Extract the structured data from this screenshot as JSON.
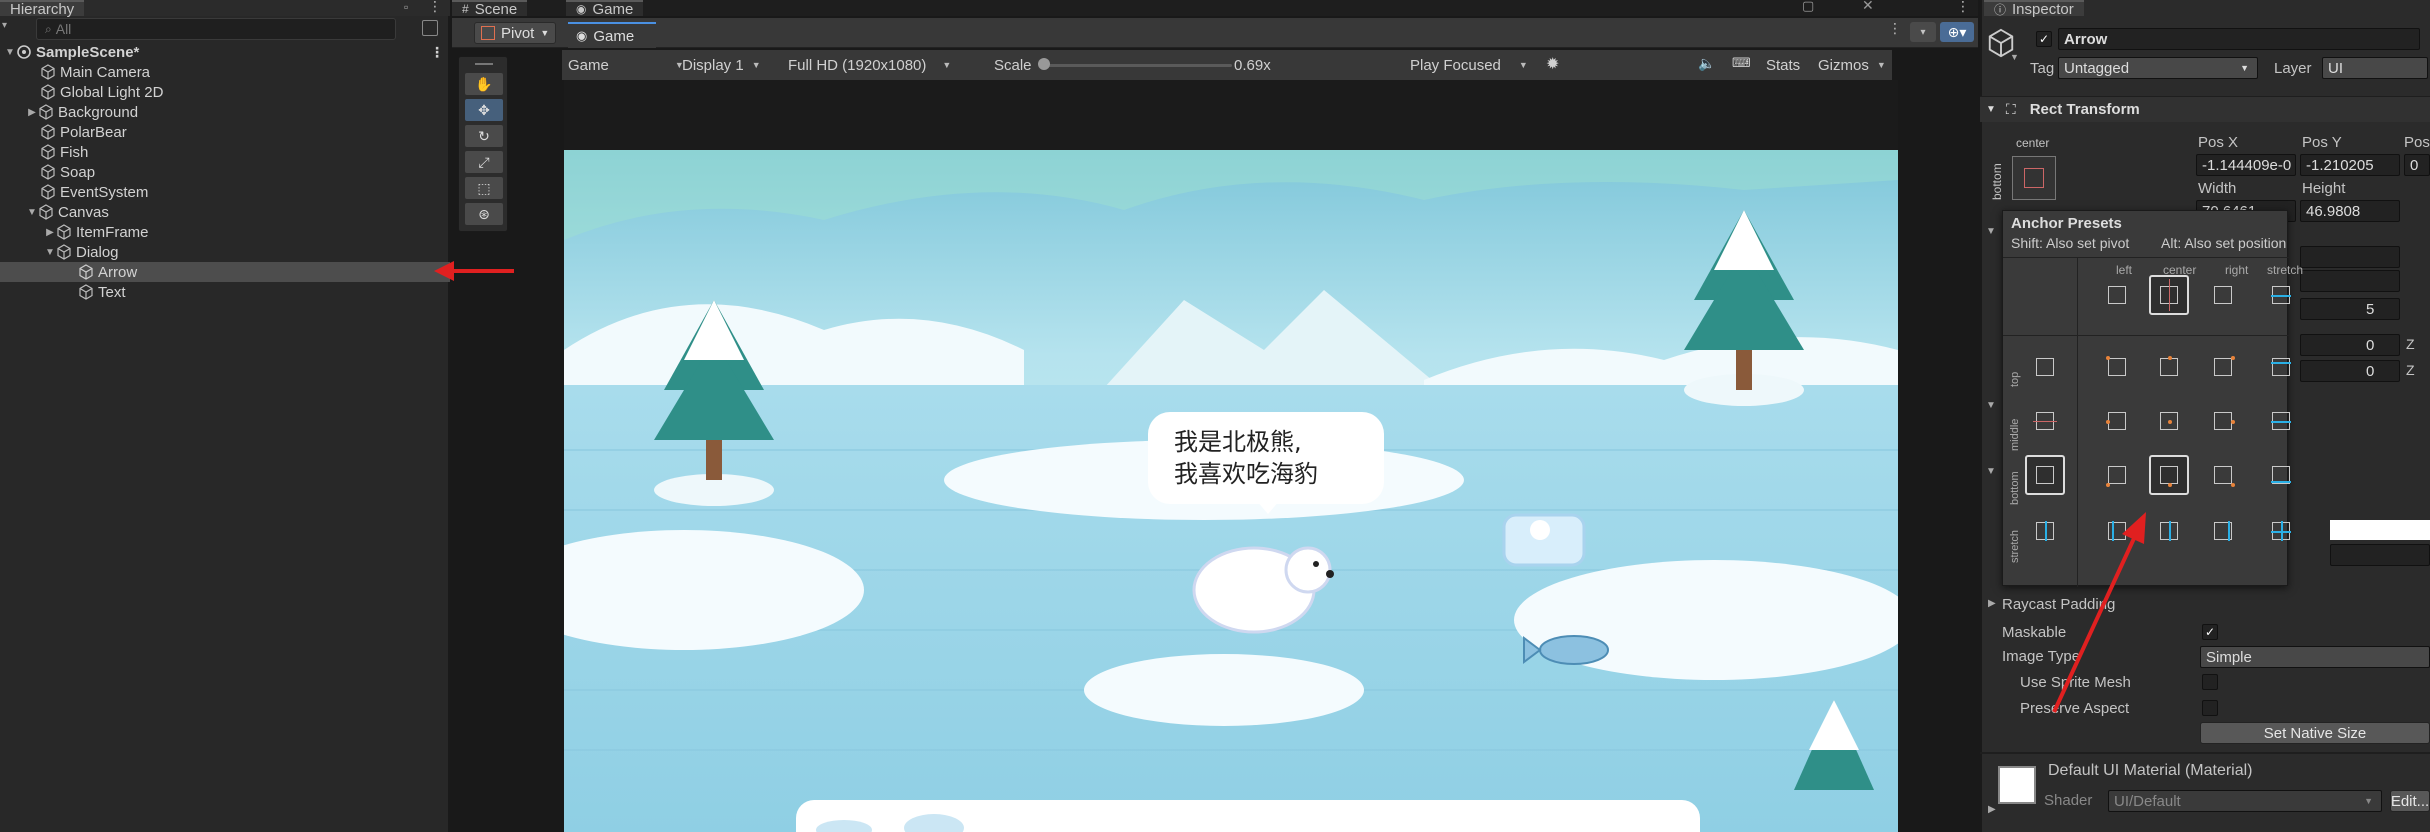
{
  "hierarchy": {
    "tab_label": "Hierarchy",
    "search_placeholder": "All",
    "items": [
      {
        "label": "SampleScene*"
      },
      {
        "label": "Main Camera"
      },
      {
        "label": "Global Light 2D"
      },
      {
        "label": "Background"
      },
      {
        "label": "PolarBear"
      },
      {
        "label": "Fish"
      },
      {
        "label": "Soap"
      },
      {
        "label": "EventSystem"
      },
      {
        "label": "Canvas"
      },
      {
        "label": "ItemFrame"
      },
      {
        "label": "Dialog"
      },
      {
        "label": "Arrow"
      },
      {
        "label": "Text"
      }
    ]
  },
  "scene_tabs": {
    "scene_label": "Scene",
    "game_label": "Game",
    "game_tab_label": "Game"
  },
  "toolbar": {
    "pivot_label": "Pivot"
  },
  "game_toolbar": {
    "mode": "Game",
    "display": "Display 1",
    "resolution": "Full HD (1920x1080)",
    "scale_label": "Scale",
    "scale_value": "0.69x",
    "play_mode": "Play Focused",
    "stats": "Stats",
    "gizmos": "Gizmos"
  },
  "game": {
    "bubble_line1": "我是北极熊,",
    "bubble_line2": "我喜欢吃海豹"
  },
  "inspector": {
    "tab_label": "Inspector",
    "object_name": "Arrow",
    "tag_label": "Tag",
    "tag_value": "Untagged",
    "layer_label": "Layer",
    "layer_value": "UI",
    "rect_transform_title": "Rect Transform",
    "anchor_h": "center",
    "anchor_v": "bottom",
    "pos_x_label": "Pos X",
    "pos_y_label": "Pos Y",
    "pos_z_label": "Pos",
    "pos_x": "-1.144409e-0",
    "pos_y": "-1.210205",
    "pos_z": "0",
    "width_label": "Width",
    "height_label": "Height",
    "width": "70.6461",
    "height": "46.9808",
    "partial_5": "5",
    "partial_0a": "0",
    "partial_0b": "0",
    "z_label": "Z",
    "raycast_padding": "Raycast Padding",
    "maskable": "Maskable",
    "image_type_label": "Image Type",
    "image_type_value": "Simple",
    "use_sprite_mesh": "Use Sprite Mesh",
    "preserve_aspect": "Preserve Aspect",
    "set_native_size": "Set Native Size",
    "material_name": "Default UI Material (Material)",
    "shader_label": "Shader",
    "shader_value": "UI/Default",
    "edit_button": "Edit..."
  },
  "anchor_presets": {
    "title": "Anchor Presets",
    "hint_shift": "Shift: Also set pivot",
    "hint_alt": "Alt: Also set position",
    "col_labels": [
      "left",
      "center",
      "right",
      "stretch"
    ],
    "row_labels": [
      "top",
      "middle",
      "bottom",
      "stretch"
    ]
  },
  "colors": {
    "accent": "#4a90e2",
    "annotation_red": "#e02020",
    "selection": "#4d4d4d"
  }
}
